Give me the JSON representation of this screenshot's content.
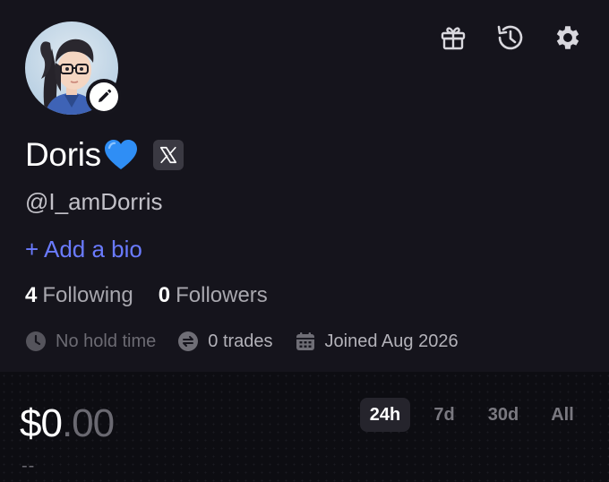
{
  "header": {
    "icons": [
      "gift-icon",
      "history-icon",
      "settings-gear-icon"
    ]
  },
  "profile": {
    "name": "Doris",
    "name_emoji": "blue-heart",
    "handle": "@I_amDorris",
    "add_bio_label": "+ Add a bio",
    "following_count": "4",
    "following_label": "Following",
    "followers_count": "0",
    "followers_label": "Followers",
    "hold_time": "No hold time",
    "trades": "0 trades",
    "joined": "Joined Aug 2026"
  },
  "balance": {
    "main": "$0",
    "cents": ".00",
    "change": "--"
  },
  "timeframe": {
    "tabs": [
      "24h",
      "7d",
      "30d",
      "All"
    ],
    "selected": "24h"
  },
  "colors": {
    "background": "#15141c",
    "accent": "#6a7bff",
    "heart": "#2f8ef5"
  }
}
